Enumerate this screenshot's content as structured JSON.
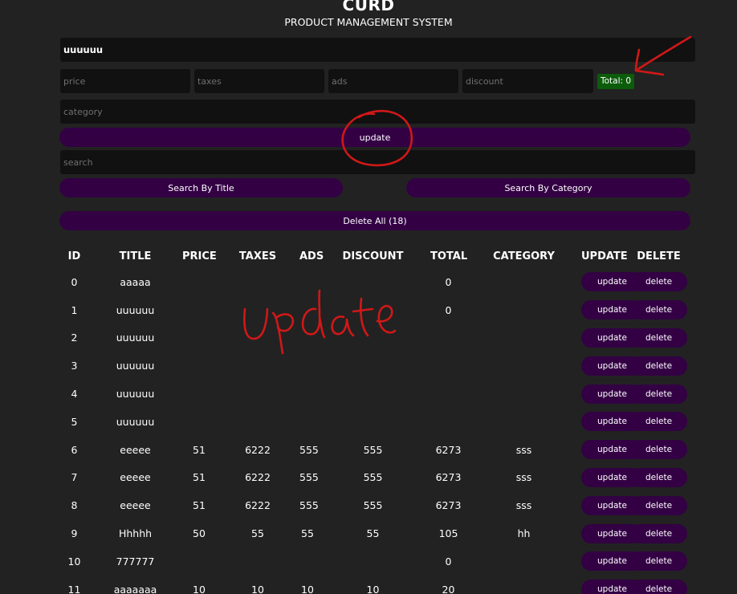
{
  "app": {
    "title": "CURD",
    "subtitle": "PRODUCT MANAGEMENT SYSTEM"
  },
  "form": {
    "title_value": "uuuuuu",
    "price_placeholder": "price",
    "taxes_placeholder": "taxes",
    "ads_placeholder": "ads",
    "discount_placeholder": "discount",
    "total_label": "Total: 0",
    "category_placeholder": "category",
    "submit_label": "update",
    "search_placeholder": "search",
    "search_title_label": "Search By Title",
    "search_category_label": "Search By Category",
    "delete_all_label": "Delete All (18)"
  },
  "table": {
    "headers": [
      "ID",
      "TITLE",
      "PRICE",
      "TAXES",
      "ADS",
      "DISCOUNT",
      "TOTAL",
      "CATEGORY",
      "UPDATE",
      "DELETE"
    ],
    "update_label": "update",
    "delete_label": "delete",
    "rows": [
      {
        "id": "0",
        "title": "aaaaa",
        "price": "",
        "taxes": "",
        "ads": "",
        "discount": "",
        "total": "0",
        "category": ""
      },
      {
        "id": "1",
        "title": "uuuuuu",
        "price": "",
        "taxes": "",
        "ads": "",
        "discount": "",
        "total": "0",
        "category": ""
      },
      {
        "id": "2",
        "title": "uuuuuu",
        "price": "",
        "taxes": "",
        "ads": "",
        "discount": "",
        "total": "",
        "category": ""
      },
      {
        "id": "3",
        "title": "uuuuuu",
        "price": "",
        "taxes": "",
        "ads": "",
        "discount": "",
        "total": "",
        "category": ""
      },
      {
        "id": "4",
        "title": "uuuuuu",
        "price": "",
        "taxes": "",
        "ads": "",
        "discount": "",
        "total": "",
        "category": ""
      },
      {
        "id": "5",
        "title": "uuuuuu",
        "price": "",
        "taxes": "",
        "ads": "",
        "discount": "",
        "total": "",
        "category": ""
      },
      {
        "id": "6",
        "title": "eeeee",
        "price": "51",
        "taxes": "6222",
        "ads": "555",
        "discount": "555",
        "total": "6273",
        "category": "sss"
      },
      {
        "id": "7",
        "title": "eeeee",
        "price": "51",
        "taxes": "6222",
        "ads": "555",
        "discount": "555",
        "total": "6273",
        "category": "sss"
      },
      {
        "id": "8",
        "title": "eeeee",
        "price": "51",
        "taxes": "6222",
        "ads": "555",
        "discount": "555",
        "total": "6273",
        "category": "sss"
      },
      {
        "id": "9",
        "title": "Hhhhh",
        "price": "50",
        "taxes": "55",
        "ads": "55",
        "discount": "55",
        "total": "105",
        "category": "hh"
      },
      {
        "id": "10",
        "title": "777777",
        "price": "",
        "taxes": "",
        "ads": "",
        "discount": "",
        "total": "0",
        "category": ""
      },
      {
        "id": "11",
        "title": "aaaaaaa",
        "price": "10",
        "taxes": "10",
        "ads": "10",
        "discount": "10",
        "total": "20",
        "category": ""
      }
    ]
  },
  "annotations": {
    "handwritten_text": "Update",
    "ink_color": "#d01818"
  },
  "colors": {
    "background": "#222222",
    "input_background": "#111111",
    "button_purple": "#330044",
    "total_green": "#0b5c0b"
  }
}
